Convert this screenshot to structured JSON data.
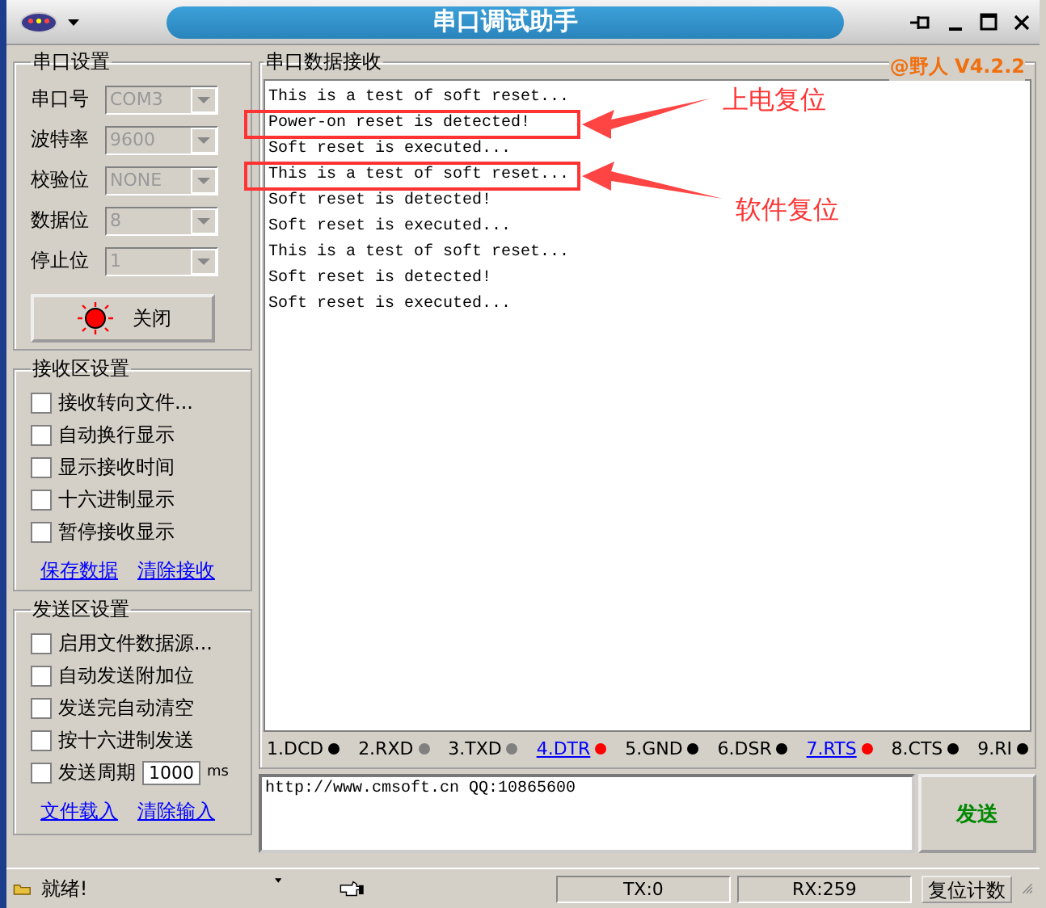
{
  "window": {
    "title": "串口调试助手"
  },
  "port_settings": {
    "title": "串口设置",
    "fields": [
      {
        "label": "串口号",
        "value": "COM3",
        "disabled": true
      },
      {
        "label": "波特率",
        "value": "9600",
        "disabled": true
      },
      {
        "label": "校验位",
        "value": "NONE",
        "disabled": true
      },
      {
        "label": "数据位",
        "value": "8",
        "disabled": true
      },
      {
        "label": "停止位",
        "value": "1",
        "disabled": true
      }
    ],
    "open_button": {
      "label": "关闭",
      "on": true
    }
  },
  "receive_settings": {
    "title": "接收区设置",
    "options": [
      {
        "label": "接收转向文件...",
        "checked": false
      },
      {
        "label": "自动换行显示",
        "checked": false
      },
      {
        "label": "显示接收时间",
        "checked": false
      },
      {
        "label": "十六进制显示",
        "checked": false
      },
      {
        "label": "暂停接收显示",
        "checked": false
      }
    ],
    "links": [
      "保存数据",
      "清除接收"
    ]
  },
  "send_settings": {
    "title": "发送区设置",
    "options": [
      {
        "label": "启用文件数据源...",
        "checked": false
      },
      {
        "label": "自动发送附加位",
        "checked": false
      },
      {
        "label": "发送完自动清空",
        "checked": false
      },
      {
        "label": "按十六进制发送",
        "checked": false
      },
      {
        "label": "发送周期",
        "checked": false,
        "period": "1000",
        "unit": "ms"
      }
    ],
    "links": [
      "文件载入",
      "清除输入"
    ]
  },
  "receive": {
    "title": "串口数据接收",
    "version": "@野人 V4.2.2",
    "lines": [
      {
        "text": "This is a test of soft reset...",
        "highlighted": false
      },
      {
        "text": "Power-on reset is detected!",
        "highlighted": true
      },
      {
        "text": "Soft reset is executed...",
        "highlighted": false
      },
      {
        "text": "This is a test of soft reset...",
        "highlighted": true
      },
      {
        "text": "Soft reset is detected!",
        "highlighted": false
      },
      {
        "text": "Soft reset is executed...",
        "highlighted": false
      },
      {
        "text": "This is a test of soft reset...",
        "highlighted": false
      },
      {
        "text": "Soft reset is detected!",
        "highlighted": false
      },
      {
        "text": "Soft reset is executed...",
        "highlighted": false
      }
    ],
    "annotations": [
      "上电复位",
      "软件复位"
    ]
  },
  "signals": [
    {
      "label": "1.DCD",
      "kind": "label",
      "color": "#000000"
    },
    {
      "label": "2.RXD",
      "kind": "label",
      "color": "#808080"
    },
    {
      "label": "3.TXD",
      "kind": "label",
      "color": "#808080"
    },
    {
      "label": "4.DTR",
      "kind": "link",
      "color": "#ff0000"
    },
    {
      "label": "5.GND",
      "kind": "label",
      "color": "#000000"
    },
    {
      "label": "6.DSR",
      "kind": "label",
      "color": "#000000"
    },
    {
      "label": "7.RTS",
      "kind": "link",
      "color": "#ff0000"
    },
    {
      "label": "8.CTS",
      "kind": "label",
      "color": "#000000"
    },
    {
      "label": "9.RI",
      "kind": "label",
      "color": "#000000"
    }
  ],
  "send": {
    "value": "http://www.cmsoft.cn QQ:10865600",
    "button": "发送"
  },
  "status_bar": {
    "message": "就绪!",
    "tx": "TX:0",
    "rx": "RX:259",
    "reset_button": "复位计数"
  }
}
